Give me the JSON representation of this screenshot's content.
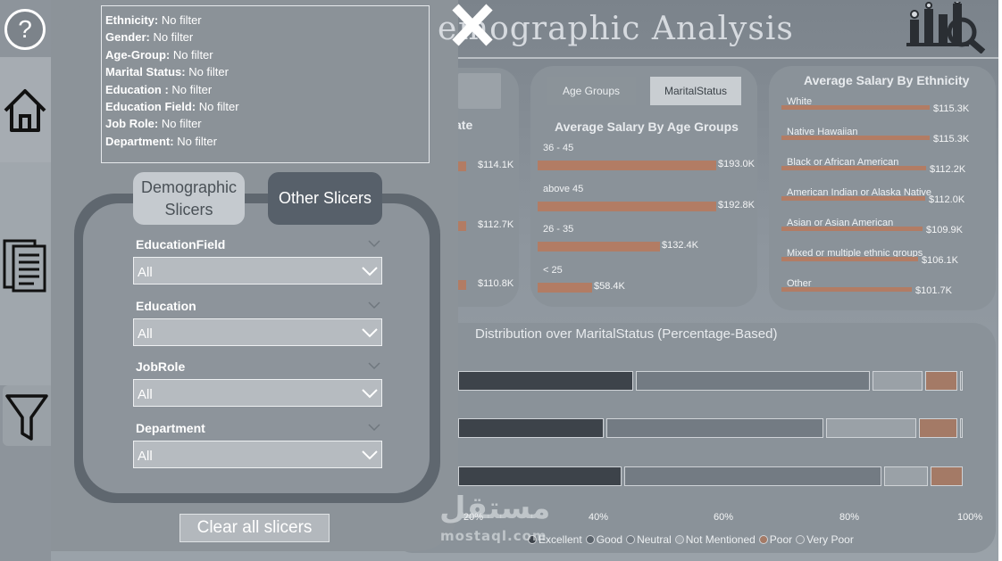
{
  "report": {
    "title": "Demographic Analysis",
    "visible_title": "mographic Analysis",
    "visible_title_prefix": "e"
  },
  "nav": {
    "help_label": "?",
    "items": [
      "home-icon",
      "report-icon",
      "filter-icon"
    ]
  },
  "filters_summary": [
    {
      "key": "Ethnicity:",
      "value": " No filter"
    },
    {
      "key": "Gender:",
      "value": " No filter"
    },
    {
      "key": "Age-Group:",
      "value": " No filter"
    },
    {
      "key": "Marital Status:",
      "value": " No filter"
    },
    {
      "key": "Education :",
      "value": " No filter"
    },
    {
      "key": "Education Field:",
      "value": " No filter"
    },
    {
      "key": "Job Role:",
      "value": " No filter"
    },
    {
      "key": "Department:",
      "value": " No filter"
    }
  ],
  "panel": {
    "tab_demographic_line1": "Demographic",
    "tab_demographic_line2": "Slicers",
    "tab_other": "Other Slicers",
    "slicers": [
      {
        "label": "EducationField",
        "value": "All"
      },
      {
        "label": "Education",
        "value": "All"
      },
      {
        "label": "JobRole",
        "value": "All"
      },
      {
        "label": "Department",
        "value": "All"
      }
    ],
    "clear_label": "Clear all slicers"
  },
  "left_card": {
    "title_fragment": "ate",
    "values": [
      "$114.1K",
      "$112.7K",
      "$110.8K"
    ]
  },
  "age_card": {
    "toggle_age": "Age Groups",
    "toggle_marital": "MaritalStatus",
    "title": "Average Salary By Age Groups",
    "rows": [
      {
        "label": "36 - 45",
        "value": 193.0,
        "text": "$193.0K"
      },
      {
        "label": "above 45",
        "value": 192.8,
        "text": "$192.8K"
      },
      {
        "label": "26 - 35",
        "value": 132.4,
        "text": "$132.4K"
      },
      {
        "label": "< 25",
        "value": 58.4,
        "text": "$58.4K"
      }
    ]
  },
  "ethnicity_card": {
    "title": "Average Salary By Ethnicity",
    "rows": [
      {
        "label": "White",
        "value": 115.3,
        "text": "$115.3K"
      },
      {
        "label": "Native Hawaiian",
        "value": 115.3,
        "text": "$115.3K"
      },
      {
        "label": "Black or African American",
        "value": 112.2,
        "text": "$112.2K"
      },
      {
        "label": "American Indian or Alaska Native",
        "value": 112.0,
        "text": "$112.0K"
      },
      {
        "label": "Asian or Asian American",
        "value": 109.9,
        "text": "$109.9K"
      },
      {
        "label": "Mixed or multiple ethnic groups",
        "value": 106.1,
        "text": "$106.1K"
      },
      {
        "label": "Other",
        "value": 101.7,
        "text": "$101.7K"
      }
    ]
  },
  "distribution": {
    "title": "Distribution over MaritalStatus (Percentage-Based)",
    "ticks": [
      "20%",
      "40%",
      "60%",
      "80%",
      "100%"
    ],
    "legend": [
      {
        "name": "Excellent",
        "color": "#3d434a"
      },
      {
        "name": "Good",
        "color": "#5b636b"
      },
      {
        "name": "Neutral",
        "color": "#737b83"
      },
      {
        "name": "Not Mentioned",
        "color": "#9aa1a7"
      },
      {
        "name": "Poor",
        "color": "#a47a66"
      },
      {
        "name": "Very Poor",
        "color": "#8c9399"
      }
    ]
  },
  "chart_data": {
    "type": "bar",
    "stacked": true,
    "orientation": "horizontal",
    "title": "Distribution over MaritalStatus (Percentage-Based)",
    "x_ticks": [
      "20%",
      "40%",
      "60%",
      "80%",
      "100%"
    ],
    "rows": [
      {
        "segments": [
          {
            "series": "Excellent",
            "end": 0.43
          },
          {
            "series": "Neutral",
            "end": 0.84
          },
          {
            "series": "Not Mentioned",
            "end": 0.93
          },
          {
            "series": "Poor",
            "end": 0.99
          },
          {
            "series": "Very Poor",
            "end": 1.0
          }
        ]
      },
      {
        "segments": [
          {
            "series": "Excellent",
            "end": 0.38
          },
          {
            "series": "Neutral",
            "end": 0.76
          },
          {
            "series": "Not Mentioned",
            "end": 0.92
          },
          {
            "series": "Poor",
            "end": 0.99
          },
          {
            "series": "Very Poor",
            "end": 1.0
          }
        ]
      },
      {
        "segments": [
          {
            "series": "Excellent",
            "end": 0.41
          },
          {
            "series": "Neutral",
            "end": 0.86
          },
          {
            "series": "Not Mentioned",
            "end": 0.94
          },
          {
            "series": "Poor",
            "end": 1.0
          }
        ]
      }
    ],
    "colors": {
      "Excellent": "#3d434a",
      "Neutral": "#737b83",
      "Not Mentioned": "#9aa1a7",
      "Poor": "#a47a66",
      "Very Poor": "#8c9399"
    }
  },
  "watermark": {
    "arabic": "مستقل",
    "latin": "mostaql.com"
  }
}
